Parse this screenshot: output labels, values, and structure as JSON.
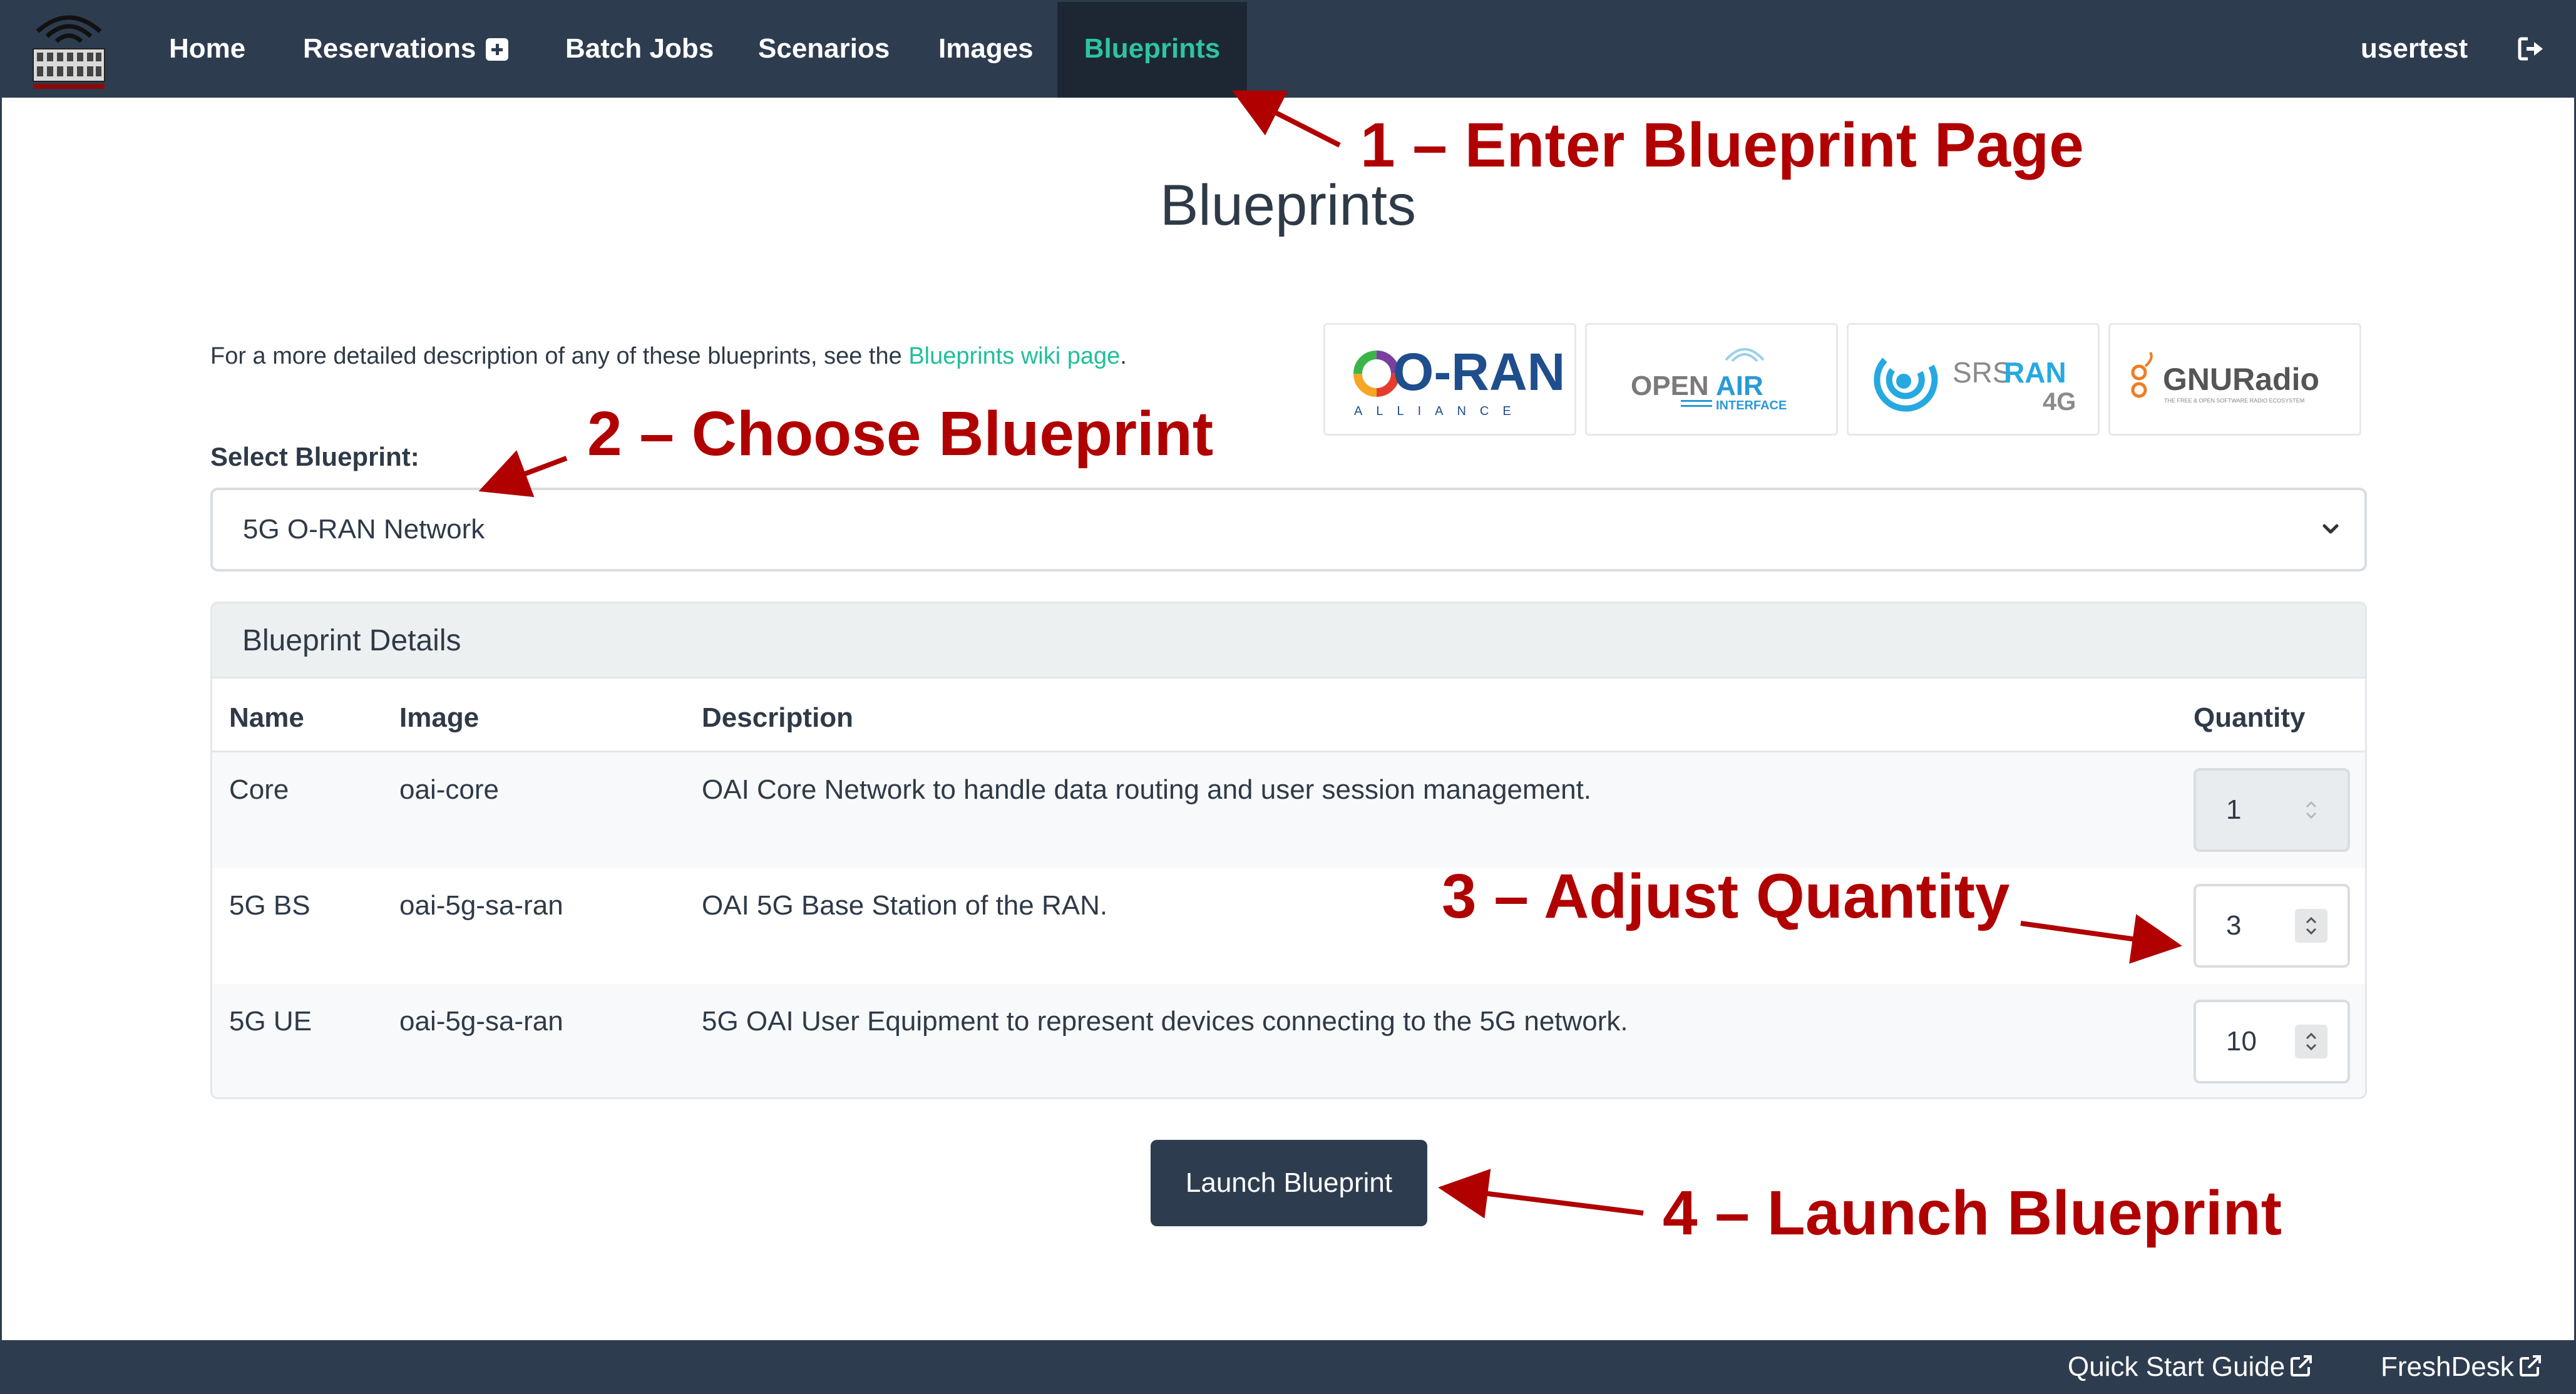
{
  "navbar": {
    "items": [
      {
        "label": "Home"
      },
      {
        "label": "Reservations"
      },
      {
        "label": "Batch Jobs"
      },
      {
        "label": "Scenarios"
      },
      {
        "label": "Images"
      },
      {
        "label": "Blueprints"
      }
    ],
    "active_index": 5,
    "user": "usertest",
    "logout_icon": "sign-out-icon"
  },
  "page": {
    "title": "Blueprints",
    "intro_text": "For a more detailed description of any of these blueprints, see the ",
    "intro_link": "Blueprints wiki page",
    "intro_end": "."
  },
  "partner_logos": [
    {
      "text": "O-RAN",
      "subtext": "ALLIANCE"
    },
    {
      "text_a": "OPEN",
      "text_b": "AIR",
      "subtext": "INTERFACE"
    },
    {
      "text_a": "SRS",
      "text_b": "RAN",
      "subtext": "4G"
    },
    {
      "text": "GNURadio",
      "subtext": "THE FREE & OPEN SOFTWARE RADIO ECOSYSTEM"
    }
  ],
  "select": {
    "label": "Select Blueprint:",
    "value": "5G O-RAN Network"
  },
  "details": {
    "title": "Blueprint Details",
    "columns": [
      "Name",
      "Image",
      "Description",
      "Quantity"
    ],
    "rows": [
      {
        "name": "Core",
        "image": "oai-core",
        "description": "OAI Core Network to handle data routing and user session management.",
        "quantity": "1"
      },
      {
        "name": "5G BS",
        "image": "oai-5g-sa-ran",
        "description": "OAI 5G Base Station of the RAN.",
        "quantity": "3"
      },
      {
        "name": "5G UE",
        "image": "oai-5g-sa-ran",
        "description": "5G OAI User Equipment to represent devices connecting to the 5G network.",
        "quantity": "10"
      }
    ]
  },
  "launch_label": "Launch Blueprint",
  "footer": {
    "quick_start": "Quick Start Guide",
    "freshdesk": "FreshDesk"
  },
  "annotations": {
    "step1": "1 – Enter Blueprint Page",
    "step2": "2 – Choose Blueprint",
    "step3": "3 – Adjust Quantity",
    "step4": "4 – Launch Blueprint"
  },
  "colors": {
    "navbar": "#2e3c4f",
    "accent": "#2ec4a0",
    "annotation": "#b00000",
    "button": "#2e3c4f"
  }
}
